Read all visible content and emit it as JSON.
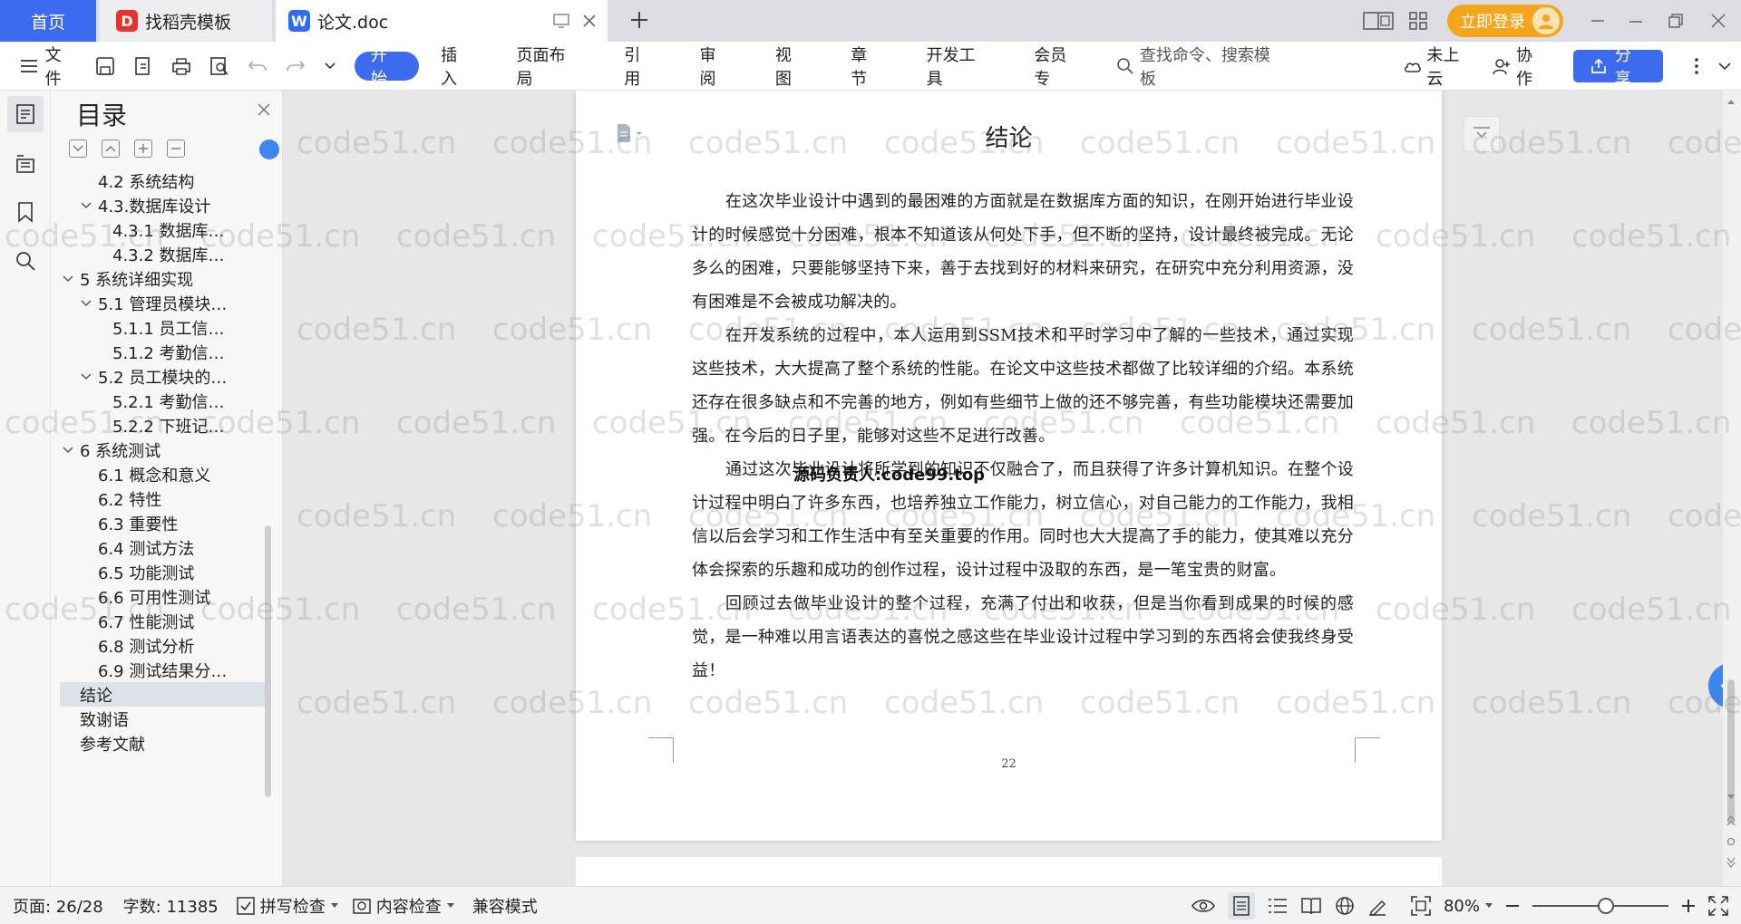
{
  "tabs": {
    "home": "首页",
    "template": "找稻壳模板",
    "document": "论文.doc"
  },
  "window": {
    "login": "立即登录"
  },
  "toolbar": {
    "file": "文件",
    "menus": [
      "开始",
      "插入",
      "页面布局",
      "引用",
      "审阅",
      "视图",
      "章节",
      "开发工具",
      "会员专"
    ],
    "search_placeholder": "查找命令、搜索模板",
    "cloud": "未上云",
    "collab": "协作",
    "share": "分享"
  },
  "toc": {
    "title": "目录",
    "items": [
      {
        "label": "4.2 系统结构",
        "level": 1,
        "arrow": ""
      },
      {
        "label": "4.3.数据库设计",
        "level": 1,
        "arrow": "v"
      },
      {
        "label": "4.3.1 数据库…",
        "level": 2,
        "arrow": ""
      },
      {
        "label": "4.3.2 数据库…",
        "level": 2,
        "arrow": ""
      },
      {
        "label": "5 系统详细实现",
        "level": 0,
        "arrow": "v"
      },
      {
        "label": "5.1  管理员模块…",
        "level": 1,
        "arrow": "v"
      },
      {
        "label": "5.1.1  员工信…",
        "level": 2,
        "arrow": ""
      },
      {
        "label": "5.1.2  考勤信…",
        "level": 2,
        "arrow": ""
      },
      {
        "label": "5.2 员工模块的…",
        "level": 1,
        "arrow": "v"
      },
      {
        "label": "5.2.1  考勤信…",
        "level": 2,
        "arrow": ""
      },
      {
        "label": "5.2.2  下班记…",
        "level": 2,
        "arrow": ""
      },
      {
        "label": "6 系统测试",
        "level": 0,
        "arrow": "v"
      },
      {
        "label": "6.1 概念和意义",
        "level": 1,
        "arrow": ""
      },
      {
        "label": "6.2 特性",
        "level": 1,
        "arrow": ""
      },
      {
        "label": "6.3 重要性",
        "level": 1,
        "arrow": ""
      },
      {
        "label": "6.4 测试方法",
        "level": 1,
        "arrow": ""
      },
      {
        "label": "6.5  功能测试",
        "level": 1,
        "arrow": ""
      },
      {
        "label": "6.6 可用性测试",
        "level": 1,
        "arrow": ""
      },
      {
        "label": "6.7 性能测试",
        "level": 1,
        "arrow": ""
      },
      {
        "label": "6.8 测试分析",
        "level": 1,
        "arrow": ""
      },
      {
        "label": "6.9 测试结果分…",
        "level": 1,
        "arrow": ""
      },
      {
        "label": "结论",
        "level": 0,
        "arrow": "",
        "selected": true
      },
      {
        "label": "致谢语",
        "level": 0,
        "arrow": ""
      },
      {
        "label": "参考文献",
        "level": 0,
        "arrow": ""
      }
    ]
  },
  "doc": {
    "title": "结论",
    "paragraphs": [
      "在这次毕业设计中遇到的最困难的方面就是在数据库方面的知识，在刚开始进行毕业设计的时候感觉十分困难，根本不知道该从何处下手，但不断的坚持，设计最终被完成。无论多么的困难，只要能够坚持下来，善于去找到好的材料来研究，在研究中充分利用资源，没有困难是不会被成功解决的。",
      "在开发系统的过程中，本人运用到SSM技术和平时学习中了解的一些技术，通过实现这些技术，大大提高了整个系统的性能。在论文中这些技术都做了比较详细的介绍。本系统还存在很多缺点和不完善的地方，例如有些细节上做的还不够完善，有些功能模块还需要加强。在今后的日子里，能够对这些不足进行改善。",
      "通过这次毕业设计将所学到的知识不仅融合了，而且获得了许多计算机知识。在整个设计过程中明白了许多东西，也培养独立工作能力，树立信心，对自己能力的工作能力，我相信以后会学习和工作生活中有至关重要的作用。同时也大大提高了手的能力，使其难以充分体会探索的乐趣和成功的创作过程，设计过程中汲取的东西，是一笔宝贵的财富。",
      "回顾过去做毕业设计的整个过程，充满了付出和收获，但是当你看到成果的时候的感觉，是一种难以用言语表达的喜悦之感这些在毕业设计过程中学习到的东西将会使我终身受益！"
    ],
    "overlay": "源码负责人:code99.top",
    "page_number": "22"
  },
  "watermark": "code51.cn",
  "status": {
    "page": "页面: 26/28",
    "words": "字数: 11385",
    "spell": "拼写检查",
    "content_check": "内容检查",
    "compat": "兼容模式",
    "zoom": "80%"
  },
  "colors": {
    "accent": "#3d6bf0",
    "login": "#f4a51c"
  }
}
